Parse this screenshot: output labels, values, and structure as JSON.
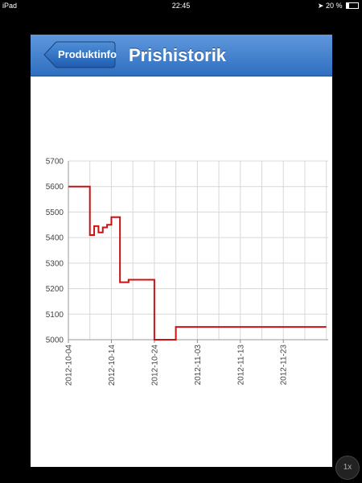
{
  "status_bar": {
    "device": "iPad",
    "time": "22:45",
    "battery": "20 %"
  },
  "nav": {
    "back_label": "Produktinfo",
    "title": "Prishistorik"
  },
  "zoom": {
    "label": "1x"
  },
  "colors": {
    "line": "#cc1111",
    "nav_top": "#5f97dc",
    "nav_bottom": "#2f6fc0"
  },
  "chart_data": {
    "type": "line",
    "x_format": "YYYY-MM-DD",
    "xlim": [
      "2012-10-04",
      "2012-12-04"
    ],
    "ylim": [
      5000,
      5700
    ],
    "yticks": [
      5000,
      5100,
      5200,
      5300,
      5400,
      5500,
      5600,
      5700
    ],
    "xticks": [
      "2012-10-04",
      "2012-10-14",
      "2012-10-24",
      "2012-11-03",
      "2012-11-13",
      "2012-11-23"
    ],
    "grid": true,
    "step": true,
    "series": [
      {
        "points": [
          [
            "2012-10-04",
            5600
          ],
          [
            "2012-10-09",
            5410
          ],
          [
            "2012-10-10",
            5445
          ],
          [
            "2012-10-11",
            5420
          ],
          [
            "2012-10-12",
            5440
          ],
          [
            "2012-10-13",
            5450
          ],
          [
            "2012-10-14",
            5480
          ],
          [
            "2012-10-16",
            5225
          ],
          [
            "2012-10-18",
            5235
          ],
          [
            "2012-10-24",
            5000
          ],
          [
            "2012-10-29",
            5050
          ],
          [
            "2012-12-03",
            5050
          ]
        ]
      }
    ]
  }
}
